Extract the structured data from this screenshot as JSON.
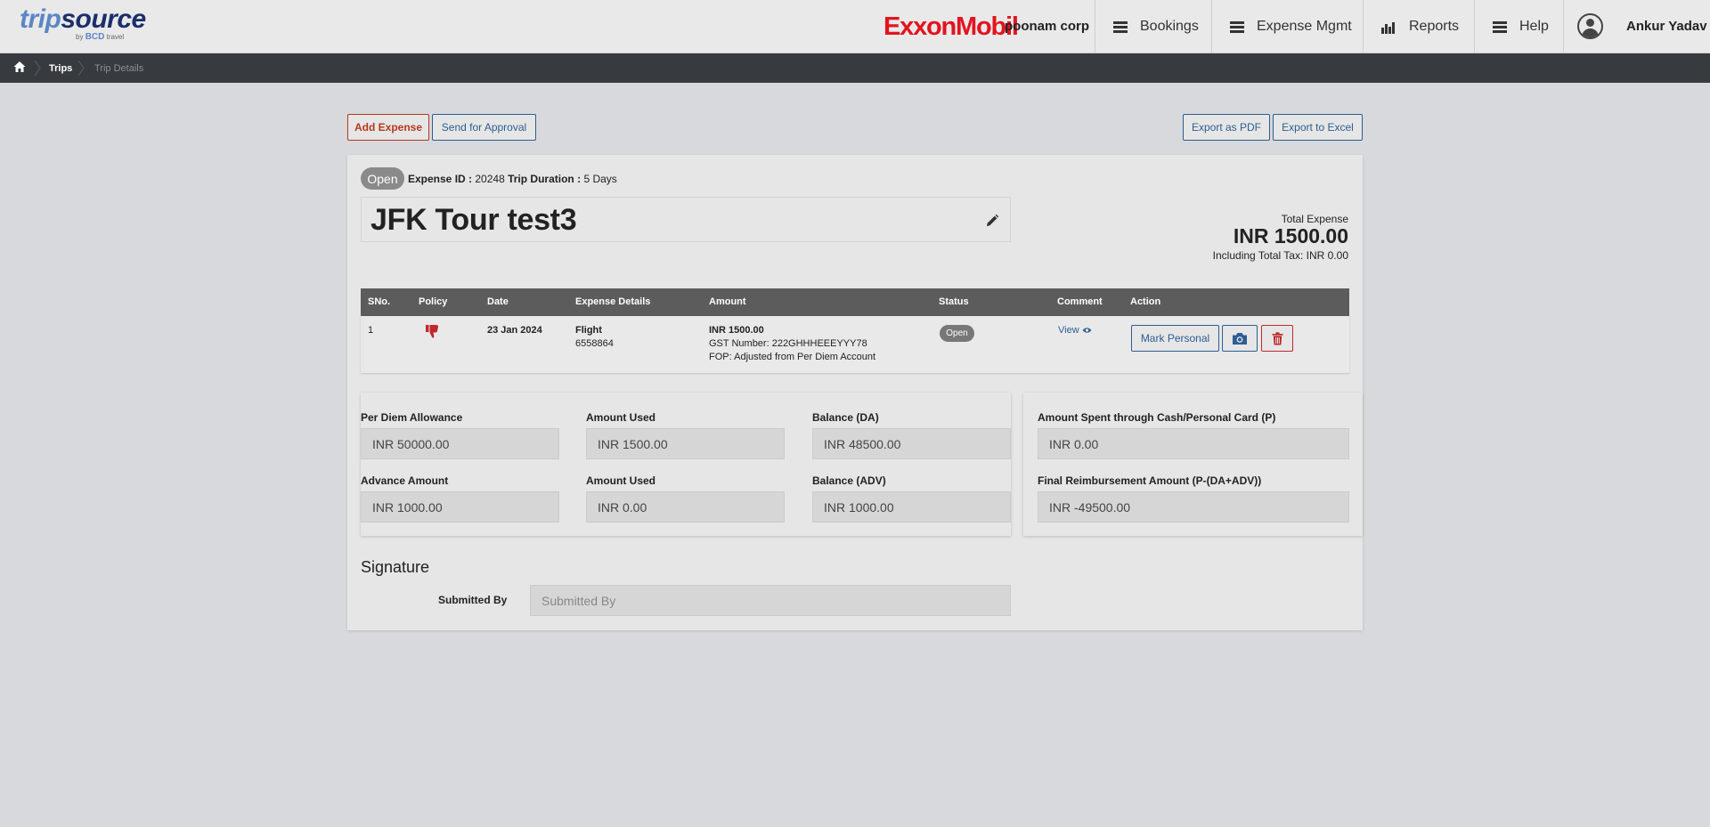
{
  "header": {
    "logo_trip": "trip",
    "logo_source": "source",
    "logo_by": "by",
    "logo_bcd": "BCD",
    "logo_travel": "travel",
    "brand": "ExxonMobil",
    "corp": "poonam corp",
    "nav": [
      {
        "label": "Bookings",
        "icon": "hamburger-icon"
      },
      {
        "label": "Expense Mgmt",
        "icon": "hamburger-icon"
      },
      {
        "label": "Reports",
        "icon": "bar-chart-icon"
      },
      {
        "label": "Help",
        "icon": "hamburger-icon"
      }
    ],
    "user": "Ankur Yadav"
  },
  "breadcrumb": {
    "items": [
      "Trips",
      "Trip Details"
    ]
  },
  "toolbar": {
    "add_expense": "Add Expense",
    "send_approval": "Send for Approval",
    "export_pdf": "Export as PDF",
    "export_excel": "Export to Excel"
  },
  "trip": {
    "status": "Open",
    "expense_id_label": "Expense ID :",
    "expense_id": "20248",
    "duration_label": "Trip Duration :",
    "duration": "5 Days",
    "title": "JFK Tour test3",
    "total_label": "Total Expense",
    "total_value": "INR 1500.00",
    "tax_line": "Including Total Tax: INR 0.00"
  },
  "table": {
    "headers": [
      "SNo.",
      "Policy",
      "Date",
      "Expense Details",
      "Amount",
      "Status",
      "Comment",
      "Action"
    ],
    "rows": [
      {
        "sno": "1",
        "date": "23 Jan 2024",
        "detail_type": "Flight",
        "detail_ref": "6558864",
        "amount": "INR 1500.00",
        "gst": "GST Number: 222GHHHEEEYYY78",
        "fop": "FOP: Adjusted from Per Diem Account",
        "status": "Open",
        "comment": "View",
        "mark_personal": "Mark Personal"
      }
    ]
  },
  "allowance": {
    "per_diem_label": "Per Diem Allowance",
    "per_diem": "INR 50000.00",
    "used_label": "Amount Used",
    "used": "INR 1500.00",
    "balance_da_label": "Balance (DA)",
    "balance_da": "INR 48500.00",
    "advance_label": "Advance Amount",
    "advance": "INR 1000.00",
    "used2_label": "Amount Used",
    "used2": "INR 0.00",
    "balance_adv_label": "Balance (ADV)",
    "balance_adv": "INR 1000.00",
    "cash_label": "Amount Spent through Cash/Personal Card (P)",
    "cash": "INR 0.00",
    "final_label": "Final Reimbursement Amount (P-(DA+ADV))",
    "final": "INR -49500.00"
  },
  "signature": {
    "title": "Signature",
    "submitted_label": "Submitted By",
    "submitted_placeholder": "Submitted By"
  },
  "colors": {
    "accent_red": "#b4391c",
    "accent_blue": "#2d5d92",
    "header_bg": "#e9e9e9",
    "crumb_bg": "#373b3f",
    "table_head": "#5c5c5c"
  }
}
